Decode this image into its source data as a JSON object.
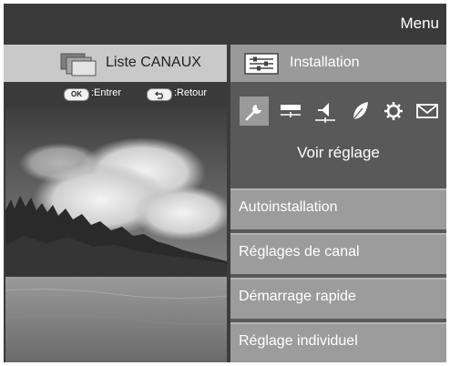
{
  "header": {
    "title": "Menu"
  },
  "tabs": {
    "channels": {
      "label": "Liste CANAUX",
      "icon": "channel-list-icon"
    },
    "installation": {
      "label": "Installation",
      "icon": "installation-icon"
    }
  },
  "hints": {
    "ok_key": "OK",
    "ok_label": ":Entrer",
    "return_label": ":Retour",
    "return_icon": "return-arrow-icon"
  },
  "preview": {
    "image": "landscape-sky-forest-photo"
  },
  "categories": [
    {
      "icon": "wrench-icon",
      "selected": true
    },
    {
      "icon": "picture-settings-icon",
      "selected": false
    },
    {
      "icon": "sound-icon",
      "selected": false
    },
    {
      "icon": "eco-leaf-icon",
      "selected": false
    },
    {
      "icon": "gear-icon",
      "selected": false
    },
    {
      "icon": "envelope-icon",
      "selected": false
    }
  ],
  "section_title": "Voir réglage",
  "menu_items": [
    {
      "label": "Autoinstallation"
    },
    {
      "label": "Réglages de canal"
    },
    {
      "label": "Démarrage rapide"
    },
    {
      "label": "Réglage individuel"
    }
  ],
  "colors": {
    "background": "#3c3c3c",
    "tab_inactive": "#c9c9c9",
    "tab_active": "#9a9a9a",
    "right_panel": "#595959",
    "menu_item": "#9c9c9c"
  }
}
